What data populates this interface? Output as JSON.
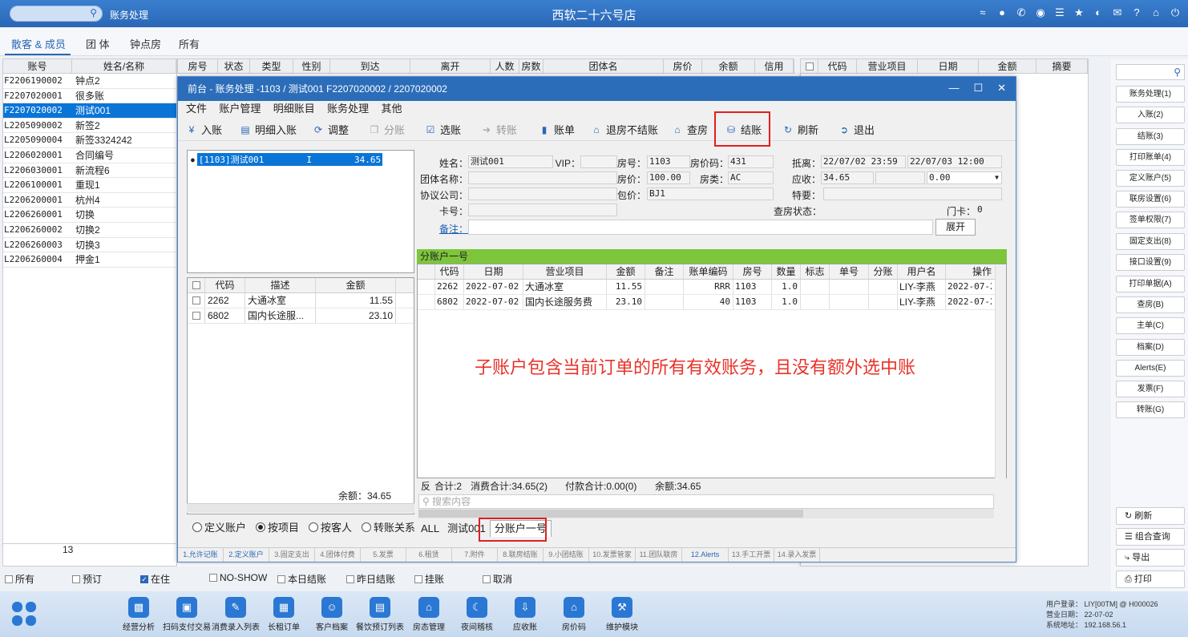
{
  "topbar": {
    "section": "账务处理",
    "store_title": "西软二十六号店"
  },
  "tabs": [
    "散客 & 成员",
    "团 体",
    "钟点房",
    "所有"
  ],
  "left_table": {
    "headers": [
      "账号",
      "姓名/名称"
    ],
    "rows": [
      [
        "F2206190002",
        "钟点2"
      ],
      [
        "F2207020001",
        "很多账"
      ],
      [
        "F2207020002",
        "测试001"
      ],
      [
        "L2205090002",
        "新签2"
      ],
      [
        "L2205090004",
        "新签3324242"
      ],
      [
        "L2206020001",
        "合同编号"
      ],
      [
        "L2206030001",
        "新流程6"
      ],
      [
        "L2206100001",
        "重现1"
      ],
      [
        "L2206200001",
        "杭州4"
      ],
      [
        "L2206260001",
        "切换"
      ],
      [
        "L2206260002",
        "切换2"
      ],
      [
        "L2206260003",
        "切换3"
      ],
      [
        "L2206260004",
        "押金1"
      ]
    ],
    "count": "13"
  },
  "main_headers": [
    "房号",
    "状态",
    "类型",
    "性别",
    "到达",
    "离开",
    "人数",
    "房数",
    "团体名",
    "房价",
    "余额",
    "信用"
  ],
  "right_headers": [
    "代码",
    "营业项目",
    "日期",
    "金额",
    "摘要"
  ],
  "sidebar": {
    "buttons": [
      "账务处理(1)",
      "入账(2)",
      "结账(3)",
      "打印账单(4)",
      "定义账户(5)",
      "联房设置(6)",
      "签单权限(7)",
      "固定支出(8)",
      "接口设置(9)",
      "打印单据(A)",
      "查房(B)",
      "主单(C)",
      "档案(D)",
      "Alerts(E)",
      "发票(F)",
      "转账(G)"
    ],
    "bottom_buttons": [
      "刷新",
      "组合查询",
      "导出",
      "打印"
    ]
  },
  "filters": [
    "所有",
    "预订",
    "在住",
    "NO-SHOW",
    "本日结账",
    "昨日结账",
    "挂账",
    "取消"
  ],
  "bottom_nav": [
    "经营分析",
    "扫码支付交易",
    "消费录入列表",
    "长租订单",
    "客户档案",
    "餐饮预订列表",
    "房态管理",
    "夜间稽核",
    "应收账",
    "房价码",
    "维护模块"
  ],
  "user_info": {
    "login": "用户登录：  LIY[00TM] @ H000026",
    "biz_date": "营业日期：   22-07-02",
    "address": "系统地址：   192.168.56.1"
  },
  "dialog": {
    "title": "前台 - 账务处理 -1103 / 测试001  F2207020002 / 2207020002",
    "menu": [
      "文件",
      "账户管理",
      "明细账目",
      "账务处理",
      "其他"
    ],
    "toolbar": [
      "入账",
      "明细入账",
      "调整",
      "分账",
      "选账",
      "转账",
      "账单",
      "退房不结账",
      "查房",
      "结账",
      "刷新",
      "退出"
    ],
    "tree_item": "[1103]测试001        I        34.65",
    "small_table": {
      "headers": [
        "代码",
        "描述",
        "金额"
      ],
      "rows": [
        [
          "2262",
          "大通冰室",
          "11.55"
        ],
        [
          "6802",
          "国内长途服...",
          "23.10"
        ]
      ],
      "balance": "余额：34.65"
    },
    "radios": [
      "定义账户",
      "按项目",
      "按客人",
      "转账关系"
    ],
    "info": {
      "name_label": "姓名：",
      "name": "测试001",
      "vip_label": "VIP：",
      "vip": "",
      "room_label": "房号：",
      "room": "1103",
      "ratecode_label": "房价码：",
      "ratecode": "431",
      "arrdep_label": "抵离：",
      "arrival": "22/07/02 23:59",
      "departure": "22/07/03 12:00",
      "group_label": "团体名称：",
      "rate_label": "房价：",
      "rate": "100.00",
      "roomtype_label": "房类：",
      "roomtype": "AC",
      "receivable_label": "应收：",
      "receivable": "34.65",
      "receivable2": "0.00",
      "company_label": "协议公司：",
      "package_label": "包价：",
      "package": "BJ1",
      "special_label": "特要：",
      "card_label": "卡号：",
      "checkroom_label": "查房状态：",
      "doorcard_label": "门卡：",
      "doorcard": "0",
      "remark_label": "备注：",
      "expand_button": "展开"
    },
    "sub_header": "分账户一号",
    "sub_table": {
      "headers": [
        "代码",
        "日期",
        "营业项目",
        "金额",
        "备注",
        "账单编码",
        "房号",
        "数量",
        "标志",
        "单号",
        "分账",
        "用户名",
        "操作"
      ],
      "rows": [
        [
          "2262",
          "2022-07-02",
          "大通冰室",
          "11.55",
          "",
          "RRR",
          "1103",
          "1.0",
          "",
          "",
          "",
          "LIY-李燕",
          "2022-07-2"
        ],
        [
          "6802",
          "2022-07-02",
          "国内长途服务费",
          "23.10",
          "",
          "40",
          "1103",
          "1.0",
          "",
          "",
          "",
          "LIY-李燕",
          "2022-07-2"
        ]
      ]
    },
    "annotation": "子账户包含当前订单的所有有效账务，且没有额外选中账",
    "totals": {
      "flag": "反",
      "count": "合计:2",
      "consume": "消费合计:34.65(2)",
      "payment": "付款合计:0.00(0)",
      "balance": "余额:34.65"
    },
    "search_placeholder": "搜索内容",
    "sub_tabs": [
      "ALL",
      "测试001",
      "分账户一号"
    ],
    "bottom_tabs": [
      "1.允许记账",
      "2.定义账户",
      "3.固定支出",
      "4.团体付费",
      "5.发票",
      "6.租赁",
      "7.附件",
      "8.联房结账",
      "9.小团结账",
      "10.发票管家",
      "11.团队联房",
      "12.Alerts",
      "13.手工开票",
      "14.录入发票"
    ]
  }
}
